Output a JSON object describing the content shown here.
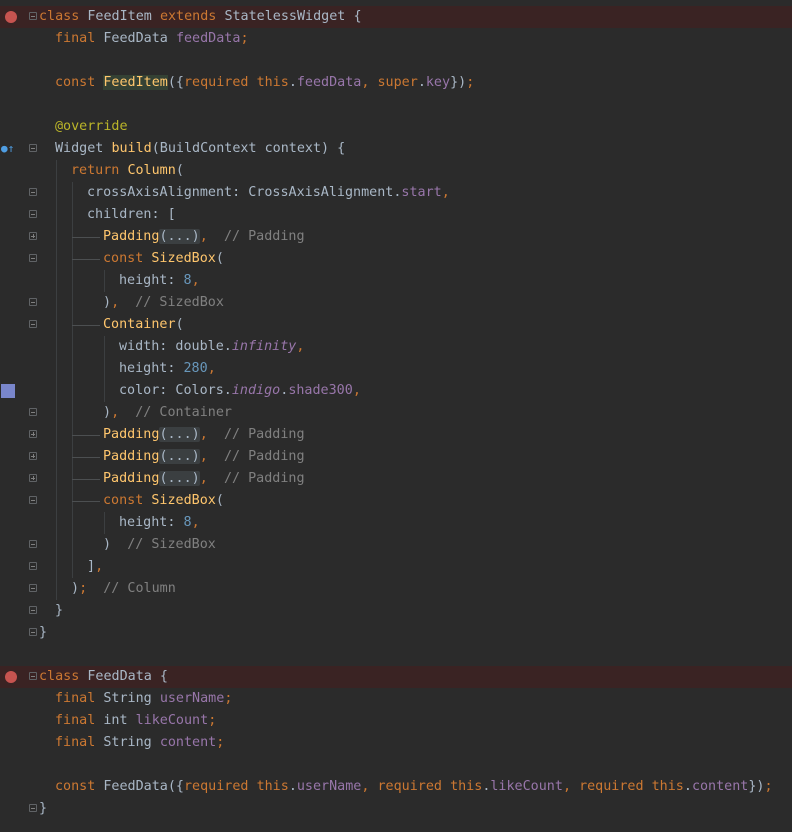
{
  "editor": {
    "lines": [
      {
        "gutter": "breakpoint",
        "fold": "minus",
        "bp": true,
        "indent": 0,
        "tokens": [
          [
            "kw",
            "class "
          ],
          [
            "cls",
            "FeedItem "
          ],
          [
            "kw",
            "extends "
          ],
          [
            "cls",
            "StatelessWidget "
          ],
          [
            "cls",
            "{"
          ]
        ]
      },
      {
        "indent": 2,
        "tokens": [
          [
            "kw",
            "final "
          ],
          [
            "cls",
            "FeedData "
          ],
          [
            "fld",
            "feedData"
          ],
          [
            "kw",
            ";"
          ]
        ]
      },
      {
        "indent": 0,
        "tokens": []
      },
      {
        "indent": 2,
        "tokens": [
          [
            "kw",
            "const "
          ],
          [
            "hlfn",
            "FeedItem"
          ],
          [
            "cls",
            "({"
          ],
          [
            "kw",
            "required "
          ],
          [
            "kw",
            "this"
          ],
          [
            "cls",
            "."
          ],
          [
            "fld",
            "feedData"
          ],
          [
            "kw",
            ", "
          ],
          [
            "kw",
            "super"
          ],
          [
            "cls",
            "."
          ],
          [
            "fld",
            "key"
          ],
          [
            "cls",
            "})"
          ],
          [
            "kw",
            ";"
          ]
        ]
      },
      {
        "indent": 0,
        "tokens": []
      },
      {
        "indent": 2,
        "tokens": [
          [
            "ann",
            "@override"
          ]
        ]
      },
      {
        "gutter": "override",
        "fold": "minus",
        "indent": 2,
        "tokens": [
          [
            "cls",
            "Widget "
          ],
          [
            "fn",
            "build"
          ],
          [
            "cls",
            "(BuildContext context) {"
          ]
        ]
      },
      {
        "indent": 4,
        "guides": [
          56
        ],
        "tokens": [
          [
            "kw",
            "return "
          ],
          [
            "fn",
            "Column"
          ],
          [
            "cls",
            "("
          ]
        ]
      },
      {
        "fold": "minus",
        "indent": 6,
        "guides": [
          56,
          72
        ],
        "tokens": [
          [
            "cls",
            "crossAxisAlignment: CrossAxisAlignment."
          ],
          [
            "fld",
            "start"
          ],
          [
            "kw",
            ","
          ]
        ]
      },
      {
        "fold": "minus",
        "indent": 6,
        "guides": [
          56,
          72
        ],
        "tokens": [
          [
            "cls",
            "children: ["
          ]
        ]
      },
      {
        "fold": "plus",
        "indent": 8,
        "guides": [
          56,
          72
        ],
        "branch": true,
        "tokens": [
          [
            "fn",
            "Padding"
          ],
          [
            "folded",
            "(...)"
          ],
          [
            "kw",
            ","
          ],
          [
            "cls",
            "  "
          ],
          [
            "cmt",
            "// Padding"
          ]
        ]
      },
      {
        "fold": "minus",
        "indent": 8,
        "guides": [
          56,
          72
        ],
        "branch": true,
        "tokens": [
          [
            "kw",
            "const "
          ],
          [
            "fn",
            "SizedBox"
          ],
          [
            "cls",
            "("
          ]
        ]
      },
      {
        "indent": 10,
        "guides": [
          56,
          72,
          104
        ],
        "tokens": [
          [
            "cls",
            "height: "
          ],
          [
            "num",
            "8"
          ],
          [
            "kw",
            ","
          ]
        ]
      },
      {
        "fold": "minus",
        "indent": 8,
        "guides": [
          56,
          72
        ],
        "tokens": [
          [
            "cls",
            ")"
          ],
          [
            "kw",
            ","
          ],
          [
            "cls",
            "  "
          ],
          [
            "cmt",
            "// SizedBox"
          ]
        ]
      },
      {
        "fold": "minus",
        "indent": 8,
        "guides": [
          56,
          72
        ],
        "branch": true,
        "tokens": [
          [
            "fn",
            "Container"
          ],
          [
            "cls",
            "("
          ]
        ]
      },
      {
        "indent": 10,
        "guides": [
          56,
          72,
          104
        ],
        "tokens": [
          [
            "cls",
            "width: double."
          ],
          [
            "it",
            "infinity"
          ],
          [
            "kw",
            ","
          ]
        ]
      },
      {
        "indent": 10,
        "guides": [
          56,
          72,
          104
        ],
        "tokens": [
          [
            "cls",
            "height: "
          ],
          [
            "num",
            "280"
          ],
          [
            "kw",
            ","
          ]
        ]
      },
      {
        "gutter": "swatch",
        "indent": 10,
        "guides": [
          56,
          72,
          104
        ],
        "tokens": [
          [
            "cls",
            "color: Colors."
          ],
          [
            "it",
            "indigo"
          ],
          [
            "cls",
            "."
          ],
          [
            "fld",
            "shade300"
          ],
          [
            "kw",
            ","
          ]
        ]
      },
      {
        "fold": "minus",
        "indent": 8,
        "guides": [
          56,
          72
        ],
        "tokens": [
          [
            "cls",
            ")"
          ],
          [
            "kw",
            ","
          ],
          [
            "cls",
            "  "
          ],
          [
            "cmt",
            "// Container"
          ]
        ]
      },
      {
        "fold": "plus",
        "indent": 8,
        "guides": [
          56,
          72
        ],
        "branch": true,
        "tokens": [
          [
            "fn",
            "Padding"
          ],
          [
            "folded",
            "(...)"
          ],
          [
            "kw",
            ","
          ],
          [
            "cls",
            "  "
          ],
          [
            "cmt",
            "// Padding"
          ]
        ]
      },
      {
        "fold": "plus",
        "indent": 8,
        "guides": [
          56,
          72
        ],
        "branch": true,
        "tokens": [
          [
            "fn",
            "Padding"
          ],
          [
            "folded",
            "(...)"
          ],
          [
            "kw",
            ","
          ],
          [
            "cls",
            "  "
          ],
          [
            "cmt",
            "// Padding"
          ]
        ]
      },
      {
        "fold": "plus",
        "indent": 8,
        "guides": [
          56,
          72
        ],
        "branch": true,
        "tokens": [
          [
            "fn",
            "Padding"
          ],
          [
            "folded",
            "(...)"
          ],
          [
            "kw",
            ","
          ],
          [
            "cls",
            "  "
          ],
          [
            "cmt",
            "// Padding"
          ]
        ]
      },
      {
        "fold": "minus",
        "indent": 8,
        "guides": [
          56,
          72
        ],
        "branch": true,
        "tokens": [
          [
            "kw",
            "const "
          ],
          [
            "fn",
            "SizedBox"
          ],
          [
            "cls",
            "("
          ]
        ]
      },
      {
        "indent": 10,
        "guides": [
          56,
          72,
          104
        ],
        "tokens": [
          [
            "cls",
            "height: "
          ],
          [
            "num",
            "8"
          ],
          [
            "kw",
            ","
          ]
        ]
      },
      {
        "fold": "minus",
        "indent": 8,
        "guides": [
          56,
          72
        ],
        "tokens": [
          [
            "cls",
            ")  "
          ],
          [
            "cmt",
            "// SizedBox"
          ]
        ]
      },
      {
        "fold": "minus",
        "indent": 6,
        "guides": [
          56,
          72
        ],
        "tokens": [
          [
            "cls",
            "]"
          ],
          [
            "kw",
            ","
          ]
        ]
      },
      {
        "fold": "minus",
        "indent": 4,
        "guides": [
          56
        ],
        "tokens": [
          [
            "cls",
            ")"
          ],
          [
            "kw",
            ";"
          ],
          [
            "cls",
            "  "
          ],
          [
            "cmt",
            "// Column"
          ]
        ]
      },
      {
        "fold": "minus",
        "indent": 2,
        "tokens": [
          [
            "cls",
            "}"
          ]
        ]
      },
      {
        "fold": "minus",
        "indent": 0,
        "tokens": [
          [
            "cls",
            "}"
          ]
        ]
      },
      {
        "indent": 0,
        "tokens": []
      },
      {
        "gutter": "breakpoint",
        "fold": "minus",
        "bp": true,
        "indent": 0,
        "tokens": [
          [
            "kw",
            "class "
          ],
          [
            "cls",
            "FeedData {"
          ]
        ]
      },
      {
        "indent": 2,
        "tokens": [
          [
            "kw",
            "final "
          ],
          [
            "cls",
            "String "
          ],
          [
            "fld",
            "userName"
          ],
          [
            "kw",
            ";"
          ]
        ]
      },
      {
        "indent": 2,
        "tokens": [
          [
            "kw",
            "final "
          ],
          [
            "cls",
            "int "
          ],
          [
            "fld",
            "likeCount"
          ],
          [
            "kw",
            ";"
          ]
        ]
      },
      {
        "indent": 2,
        "tokens": [
          [
            "kw",
            "final "
          ],
          [
            "cls",
            "String "
          ],
          [
            "fld",
            "content"
          ],
          [
            "kw",
            ";"
          ]
        ]
      },
      {
        "indent": 0,
        "tokens": []
      },
      {
        "indent": 2,
        "tokens": [
          [
            "kw",
            "const "
          ],
          [
            "cls",
            "FeedData({"
          ],
          [
            "kw",
            "required "
          ],
          [
            "kw",
            "this"
          ],
          [
            "cls",
            "."
          ],
          [
            "fld",
            "userName"
          ],
          [
            "kw",
            ", "
          ],
          [
            "kw",
            "required "
          ],
          [
            "kw",
            "this"
          ],
          [
            "cls",
            "."
          ],
          [
            "fld",
            "likeCount"
          ],
          [
            "kw",
            ", "
          ],
          [
            "kw",
            "required "
          ],
          [
            "kw",
            "this"
          ],
          [
            "cls",
            "."
          ],
          [
            "fld",
            "content"
          ],
          [
            "cls",
            "})"
          ],
          [
            "kw",
            ";"
          ]
        ]
      },
      {
        "fold": "minus",
        "indent": 0,
        "tokens": [
          [
            "cls",
            "}"
          ]
        ]
      }
    ]
  }
}
